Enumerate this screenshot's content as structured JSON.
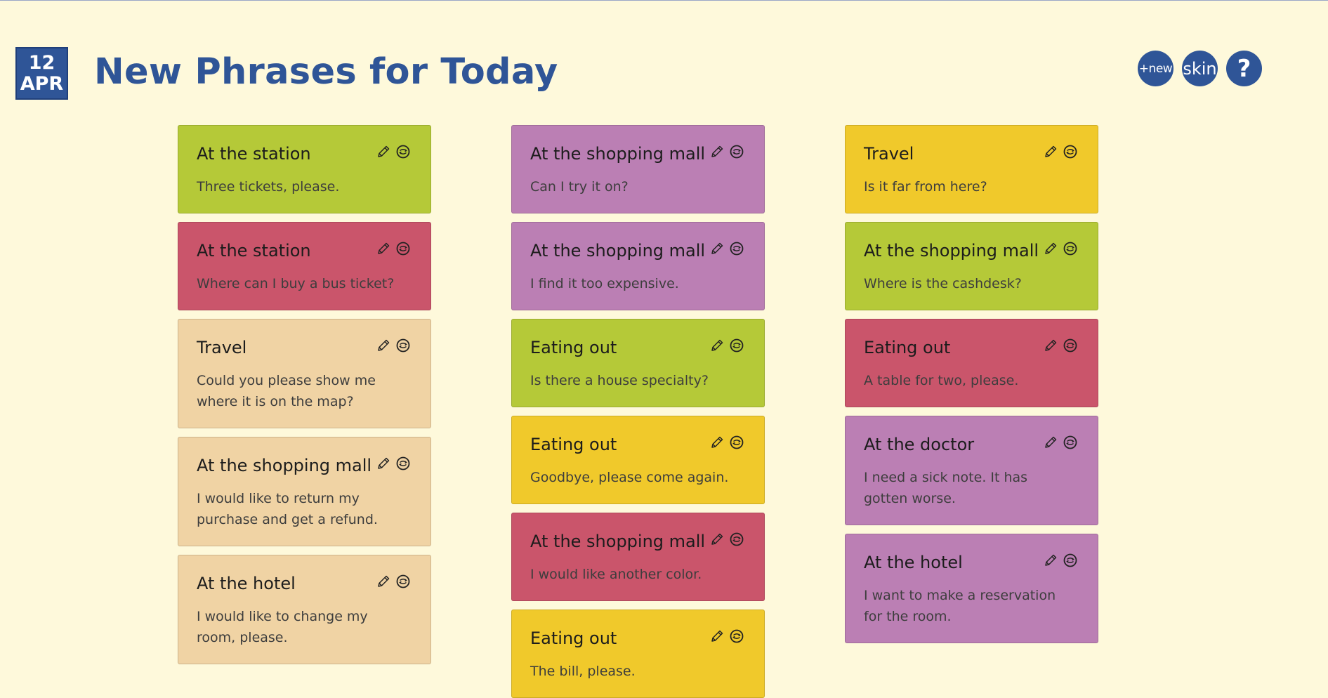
{
  "header": {
    "date_day": "12",
    "date_month": "APR",
    "title": "New Phrases for Today",
    "buttons": {
      "new": "+new",
      "skin": "skin",
      "help": "?"
    }
  },
  "columns": [
    [
      {
        "title": "At the station",
        "phrase": "Three tickets, please.",
        "color": "#b5c938"
      },
      {
        "title": "At the station",
        "phrase": "Where can I buy a bus ticket?",
        "color": "#ca556b"
      },
      {
        "title": "Travel",
        "phrase": "Could you please show me where it is on the map?",
        "color": "#f0d3a4"
      },
      {
        "title": "At the shopping mall",
        "phrase": "I would like to return my purchase and get a refund.",
        "color": "#f0d3a4"
      },
      {
        "title": "At the hotel",
        "phrase": "I would like to change my room, please.",
        "color": "#f0d3a4"
      }
    ],
    [
      {
        "title": "At the shopping mall",
        "phrase": "Can I try it on?",
        "color": "#bb7fb4"
      },
      {
        "title": "At the shopping mall",
        "phrase": "I find it too expensive.",
        "color": "#bb7fb4"
      },
      {
        "title": "Eating out",
        "phrase": "Is there a house specialty?",
        "color": "#b5c938"
      },
      {
        "title": "Eating out",
        "phrase": "Goodbye, please come again.",
        "color": "#f0c92b"
      },
      {
        "title": "At the shopping mall",
        "phrase": "I would like another color.",
        "color": "#ca556b"
      },
      {
        "title": "Eating out",
        "phrase": "The bill, please.",
        "color": "#f0c92b"
      }
    ],
    [
      {
        "title": "Travel",
        "phrase": "Is it far from here?",
        "color": "#f0c92b"
      },
      {
        "title": "At the shopping mall",
        "phrase": "Where is the cashdesk?",
        "color": "#b5c938"
      },
      {
        "title": "Eating out",
        "phrase": "A table for two, please.",
        "color": "#ca556b"
      },
      {
        "title": "At the doctor",
        "phrase": "I need a sick note. It has gotten worse.",
        "color": "#bb7fb4"
      },
      {
        "title": "At the hotel",
        "phrase": "I want to make a reservation for the room.",
        "color": "#bb7fb4"
      }
    ]
  ],
  "icons": {
    "edit": "pencil-icon",
    "refresh": "refresh-icon"
  }
}
